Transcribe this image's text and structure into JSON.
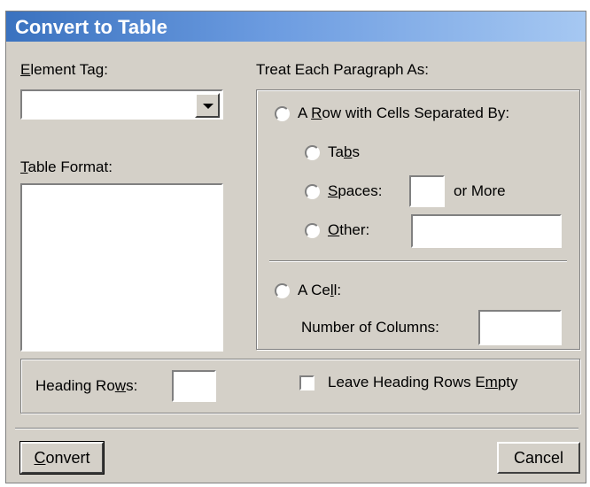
{
  "window": {
    "title": "Convert to Table"
  },
  "element_tag": {
    "label_u": "E",
    "label_rest": "lement Tag:",
    "value": ""
  },
  "table_format": {
    "label_u": "T",
    "label_rest": "able Format:"
  },
  "treat": {
    "label": "Treat Each Paragraph As:",
    "row_option": {
      "pre": "A ",
      "u": "R",
      "post": "ow with Cells Separated By:"
    },
    "tabs": {
      "pre": "Ta",
      "u": "b",
      "post": "s"
    },
    "spaces": {
      "u": "S",
      "post": "paces:",
      "value": "",
      "suffix": "or More"
    },
    "other": {
      "u": "O",
      "post": "ther:",
      "value": ""
    },
    "cell_option": {
      "pre": "A Ce",
      "u": "l",
      "post": "l:"
    },
    "columns": {
      "label": "Number of Columns:",
      "value": ""
    }
  },
  "heading": {
    "rows_label_pre": "Heading Ro",
    "rows_label_u": "w",
    "rows_label_post": "s:",
    "rows_value": "",
    "leave_empty_pre": "Leave Heading Rows E",
    "leave_empty_u": "m",
    "leave_empty_post": "pty"
  },
  "buttons": {
    "convert_u": "C",
    "convert_rest": "onvert",
    "cancel": "Cancel"
  }
}
